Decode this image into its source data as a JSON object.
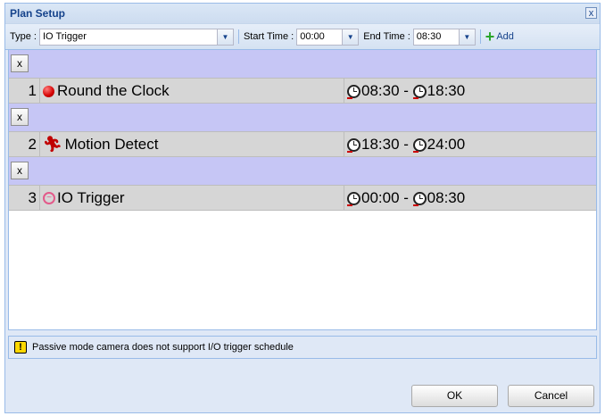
{
  "window": {
    "title": "Plan Setup",
    "close_label": "x"
  },
  "toolbar": {
    "type_label": "Type :",
    "type_value": "IO Trigger",
    "start_label": "Start Time :",
    "start_value": "00:00",
    "end_label": "End Time :",
    "end_value": "08:30",
    "add_label": "Add",
    "add_icon": "plus-icon"
  },
  "rows": [
    {
      "delete_label": "x",
      "index": "1",
      "icon": "red-dot-icon",
      "name": "Round the Clock",
      "start": "08:30",
      "sep": " - ",
      "end": "18:30"
    },
    {
      "delete_label": "x",
      "index": "2",
      "icon": "running-person-icon",
      "name": "Motion Detect",
      "start": "18:30",
      "sep": " - ",
      "end": "24:00"
    },
    {
      "delete_label": "x",
      "index": "3",
      "icon": "io-trigger-icon",
      "name": "IO Trigger",
      "start": "00:00",
      "sep": " - ",
      "end": "08:30"
    }
  ],
  "notice": {
    "icon": "warning-icon",
    "text": "Passive mode camera does not support I/O trigger schedule"
  },
  "footer": {
    "ok_label": "OK",
    "cancel_label": "Cancel"
  },
  "colors": {
    "row_header": "#c6c6f5",
    "row_body": "#d6d6d6",
    "title_text": "#15428b",
    "panel": "#dfe8f6"
  }
}
